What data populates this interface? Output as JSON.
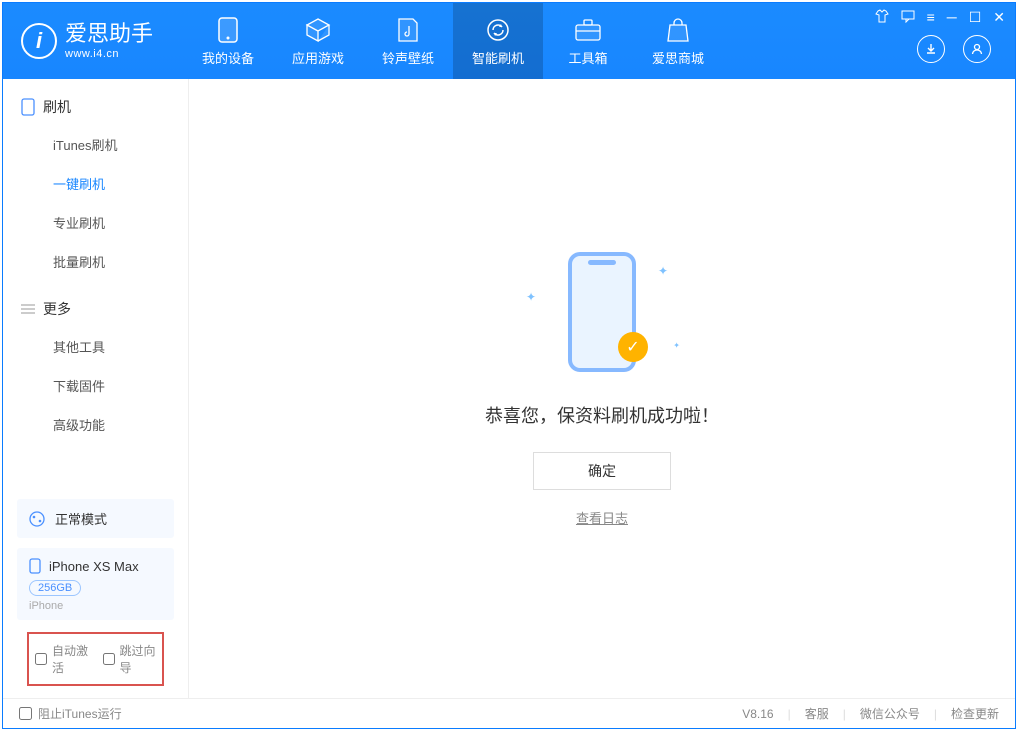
{
  "header": {
    "app_title": "爱思助手",
    "app_subtitle": "www.i4.cn",
    "nav": [
      {
        "label": "我的设备"
      },
      {
        "label": "应用游戏"
      },
      {
        "label": "铃声壁纸"
      },
      {
        "label": "智能刷机",
        "active": true
      },
      {
        "label": "工具箱"
      },
      {
        "label": "爱思商城"
      }
    ]
  },
  "sidebar": {
    "groups": [
      {
        "title": "刷机",
        "items": [
          {
            "label": "iTunes刷机"
          },
          {
            "label": "一键刷机",
            "active": true
          },
          {
            "label": "专业刷机"
          },
          {
            "label": "批量刷机"
          }
        ]
      },
      {
        "title": "更多",
        "items": [
          {
            "label": "其他工具"
          },
          {
            "label": "下载固件"
          },
          {
            "label": "高级功能"
          }
        ]
      }
    ],
    "mode": {
      "label": "正常模式"
    },
    "device": {
      "name": "iPhone XS Max",
      "storage": "256GB",
      "type": "iPhone"
    },
    "options": [
      {
        "label": "自动激活",
        "checked": false
      },
      {
        "label": "跳过向导",
        "checked": false
      }
    ]
  },
  "main": {
    "message": "恭喜您，保资料刷机成功啦！",
    "confirm_label": "确定",
    "view_log_label": "查看日志"
  },
  "footer": {
    "block_itunes_label": "阻止iTunes运行",
    "version": "V8.16",
    "links": [
      "客服",
      "微信公众号",
      "检查更新"
    ]
  }
}
